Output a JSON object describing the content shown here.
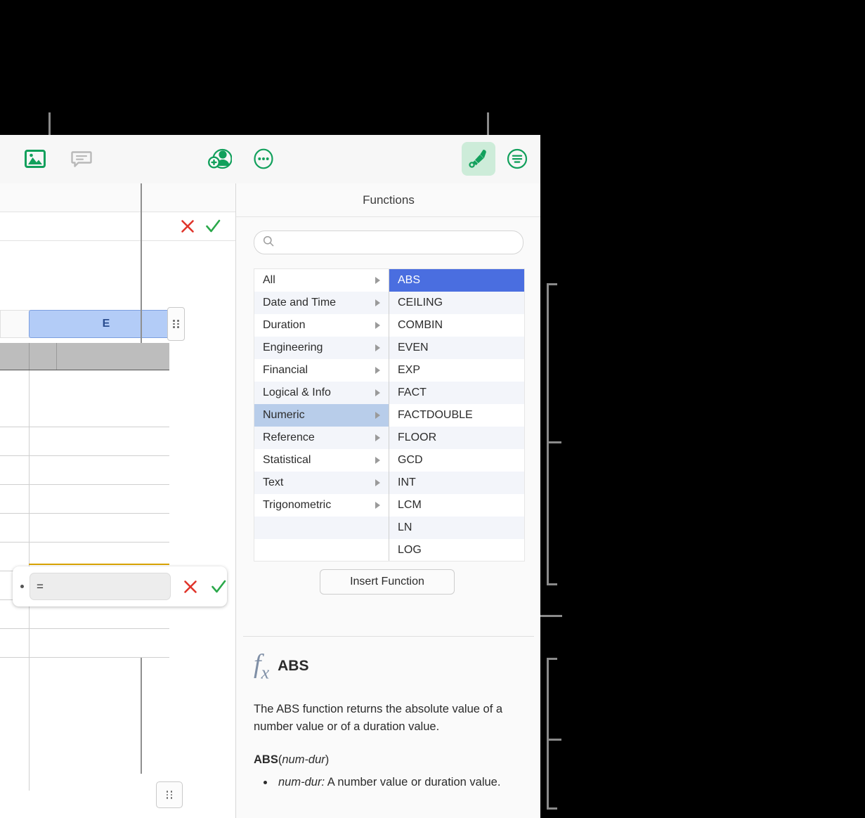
{
  "toolbar": {
    "buttons": [
      {
        "name": "media-icon",
        "label": "Media"
      },
      {
        "name": "comment-icon",
        "label": "Comment"
      },
      {
        "name": "collaborate-icon",
        "label": "Collaborate"
      },
      {
        "name": "more-icon",
        "label": "More"
      },
      {
        "name": "format-icon",
        "label": "Format"
      },
      {
        "name": "organize-icon",
        "label": "Organize"
      }
    ],
    "active_button": "format-icon",
    "active_bg": "#cdecd9",
    "accent": "#12a05c"
  },
  "sheet": {
    "column_tab_label": "E",
    "accept_label": "✓",
    "cancel_label": "✕",
    "accept_color": "#2aa84a",
    "cancel_color": "#e0352b",
    "selection_fill": "#b3ccf7",
    "selection_text": "#2a4d8f",
    "editing_border": "#d9a400"
  },
  "formula_editor": {
    "value": "=",
    "cancel_label": "✕",
    "accept_label": "✓"
  },
  "panel": {
    "title": "Functions",
    "search": {
      "value": "",
      "placeholder": ""
    },
    "categories": [
      "All",
      "Date and Time",
      "Duration",
      "Engineering",
      "Financial",
      "Logical & Info",
      "Numeric",
      "Reference",
      "Statistical",
      "Text",
      "Trigonometric"
    ],
    "selected_category": "Numeric",
    "selected_category_bg": "#b8cdea",
    "functions": [
      "ABS",
      "CEILING",
      "COMBIN",
      "EVEN",
      "EXP",
      "FACT",
      "FACTDOUBLE",
      "FLOOR",
      "GCD",
      "INT",
      "LCM",
      "LN",
      "LOG"
    ],
    "selected_function": "ABS",
    "selected_function_bg": "#4a6ee0",
    "insert_button_label": "Insert Function"
  },
  "description": {
    "icon": "fx-icon",
    "name": "ABS",
    "summary": "The ABS function returns the absolute value of a number value or of a duration value.",
    "signature_fn": "ABS",
    "signature_open": "(",
    "signature_arg": "num-dur",
    "signature_close": ")",
    "arguments": [
      {
        "term": "num-dur:",
        "text": " A number value or duration value."
      }
    ]
  }
}
